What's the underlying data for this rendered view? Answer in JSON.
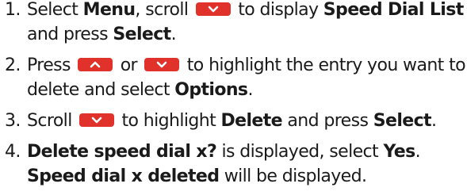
{
  "steps": [
    {
      "number": "1.",
      "parts": {
        "a": "Select ",
        "b": "Menu",
        "c": ", scroll ",
        "d": " to display ",
        "e": "Speed Dial List",
        "f": " and press ",
        "g": "Select",
        "h": "."
      }
    },
    {
      "number": "2.",
      "parts": {
        "a": "Press ",
        "b": " or ",
        "c": " to highlight the entry you want to delete and select ",
        "d": "Options",
        "e": "."
      }
    },
    {
      "number": "3.",
      "parts": {
        "a": "Scroll ",
        "b": " to highlight ",
        "c": "Delete",
        "d": " and press ",
        "e": "Select",
        "f": "."
      }
    },
    {
      "number": "4.",
      "parts": {
        "a": "Delete speed dial x?",
        "b": " is displayed, select ",
        "c": "Yes",
        "d": ". ",
        "e": "Speed dial x deleted",
        "f": " will be displayed."
      }
    }
  ],
  "icons": {
    "down_key": "chevron-down-key-icon",
    "up_key": "chevron-up-key-icon",
    "key_color": "#e0312a"
  }
}
